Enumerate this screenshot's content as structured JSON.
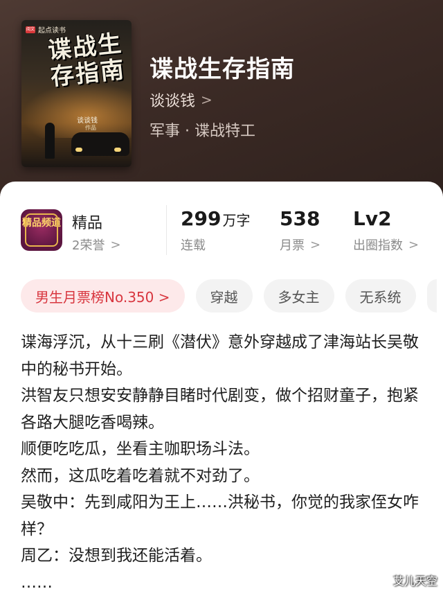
{
  "book": {
    "title": "谍战生存指南",
    "author": "谈谈钱",
    "category": "军事 · 谍战特工",
    "cover": {
      "brand": "起点读书",
      "brand_logo": "阅文",
      "title": "谍战生存指南",
      "author": "谈谈钱",
      "author_suffix": "作品"
    }
  },
  "stats": {
    "quality": {
      "label": "精品",
      "sub": "2荣誉"
    },
    "badge_text": "精品频道",
    "words": {
      "value": "299",
      "unit": "万字",
      "label": "连载"
    },
    "monthly_votes": {
      "value": "538",
      "label": "月票"
    },
    "level": {
      "value": "Lv2",
      "label": "出圈指数"
    }
  },
  "chips": [
    "男生月票榜No.350 >",
    "穿越",
    "多女主",
    "无系统"
  ],
  "description": [
    "谍海浮沉，从十三刷《潜伏》意外穿越成了津海站长吴敬中的秘书开始。",
    "洪智友只想安安静静目睹时代剧变，做个招财童子，抱紧各路大腿吃香喝辣。",
    "顺便吃吃瓜，坐看主咖职场斗法。",
    "然而，这瓜吃着吃着就不对劲了。",
    "吴敬中：先到咸阳为王上……洪秘书，你觉的我家侄女咋样？",
    "周乙：没想到我还能活着。",
    "……"
  ],
  "watermark": "艾儿天空",
  "colors": {
    "rank_chip_text": "#d8363f",
    "rank_chip_bg": "#fde9ea",
    "hero_bg": "#3f2e28"
  }
}
